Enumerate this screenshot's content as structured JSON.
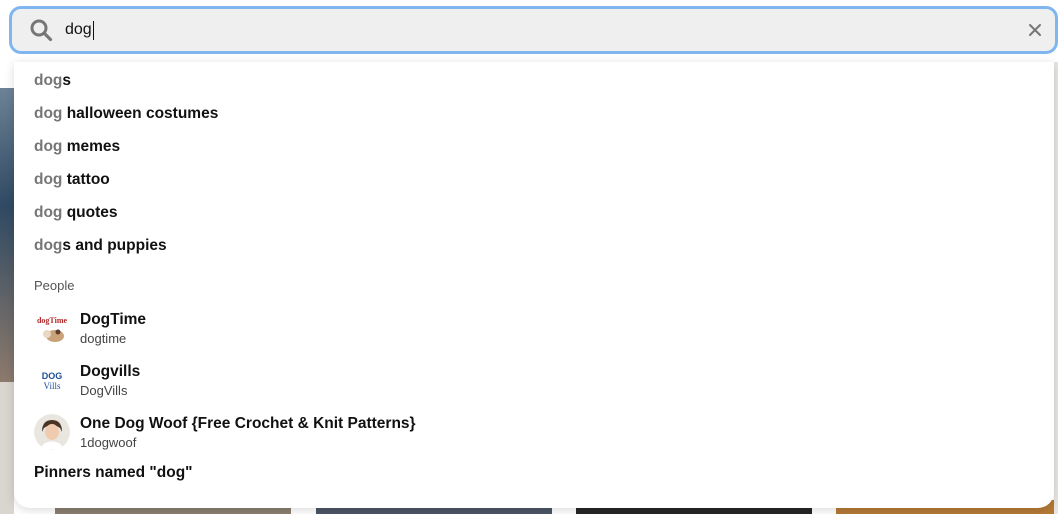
{
  "search": {
    "value": "dog",
    "clear_icon": "close-icon",
    "search_icon": "search-icon"
  },
  "suggestions": [
    {
      "match": "dog",
      "rest": "s"
    },
    {
      "match": "dog",
      "rest": " halloween costumes"
    },
    {
      "match": "dog",
      "rest": " memes"
    },
    {
      "match": "dog",
      "rest": " tattoo"
    },
    {
      "match": "dog",
      "rest": " quotes"
    },
    {
      "match": "dog",
      "rest": "s and puppies"
    }
  ],
  "people_section": {
    "label": "People",
    "people": [
      {
        "name": "DogTime",
        "username": "dogtime",
        "avatar_text": "dogTime"
      },
      {
        "name": "Dogvills",
        "username": "DogVills",
        "avatar_text_1": "DOG",
        "avatar_text_2": "Vills"
      },
      {
        "name": "One Dog Woof {Free Crochet & Knit Patterns}",
        "username": "1dogwoof"
      }
    ]
  },
  "pinners_link": "Pinners named \"dog\"",
  "colors": {
    "focus_ring": "#7fb6ef",
    "search_bg": "#efefef",
    "match_text": "#767676"
  }
}
